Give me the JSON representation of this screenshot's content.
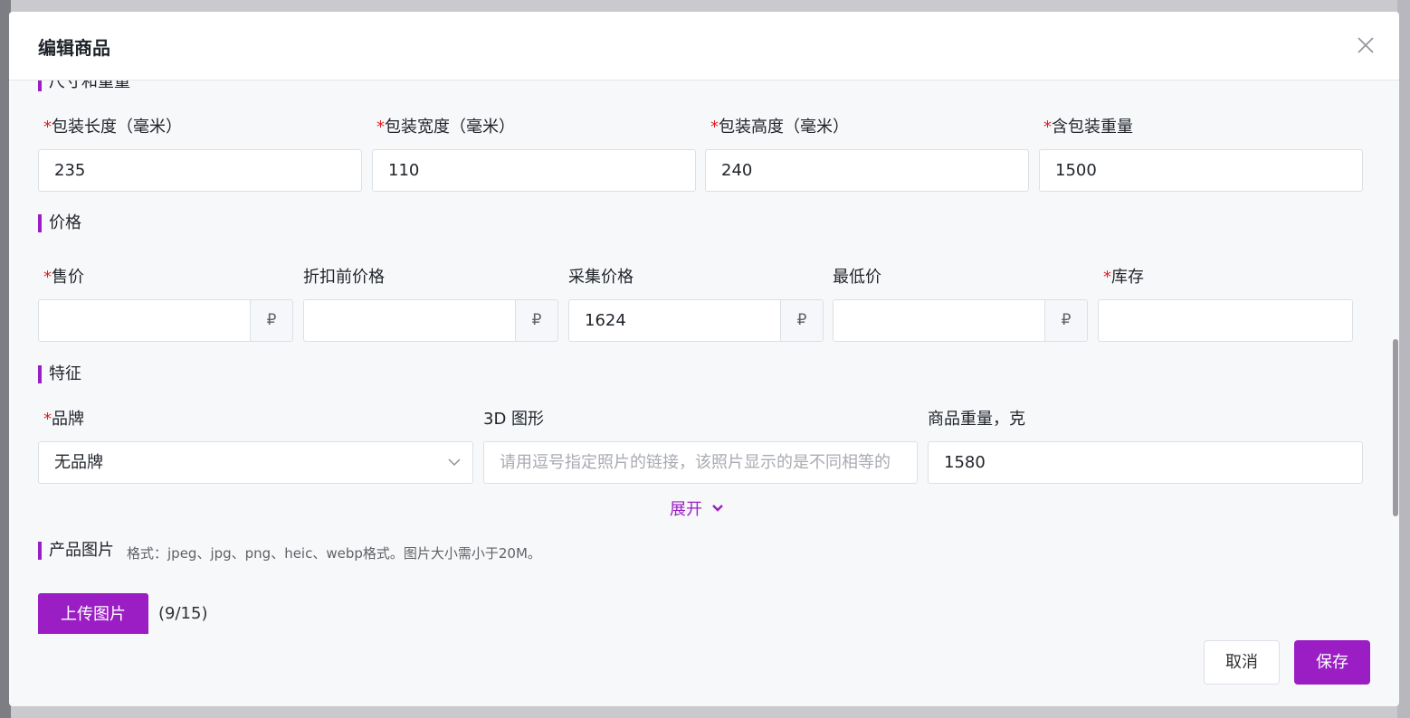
{
  "modal": {
    "title": "编辑商品"
  },
  "sections": {
    "dimensions": "尺寸和重量",
    "price": "价格",
    "features": "特征",
    "images": "产品图片"
  },
  "required_mark": "*",
  "dimensions": {
    "length": {
      "label": "包装长度（毫米）",
      "value": "235"
    },
    "width": {
      "label": "包装宽度（毫米）",
      "value": "110"
    },
    "height": {
      "label": "包装高度（毫米）",
      "value": "240"
    },
    "weight": {
      "label": "含包装重量",
      "value": "1500"
    }
  },
  "price": {
    "sale": {
      "label": "售价",
      "value": "",
      "suffix": "₽"
    },
    "original": {
      "label": "折扣前价格",
      "value": "",
      "suffix": "₽"
    },
    "collected": {
      "label": "采集价格",
      "value": "1624",
      "suffix": "₽"
    },
    "minimum": {
      "label": "最低价",
      "value": "",
      "suffix": "₽"
    },
    "stock": {
      "label": "库存",
      "value": ""
    }
  },
  "features": {
    "brand": {
      "label": "品牌",
      "value": "无品牌"
    },
    "model3d": {
      "label": "3D 图形",
      "placeholder": "请用逗号指定照片的链接，该照片显示的是不同相等的"
    },
    "item_weight": {
      "label": "商品重量，克",
      "value": "1580"
    },
    "expand_label": "展开"
  },
  "images": {
    "hint": "格式：jpeg、jpg、png、heic、webp格式。图片大小需小于20M。",
    "upload_label": "上传图片",
    "count": "(9/15)"
  },
  "footer": {
    "cancel_label": "取消",
    "save_label": "保存"
  },
  "colors": {
    "accent": "#9a1ec4",
    "required": "#e02020"
  },
  "icons": {
    "close": "close-icon",
    "select": "chevron-down-icon",
    "expand": "chevron-down-icon"
  }
}
